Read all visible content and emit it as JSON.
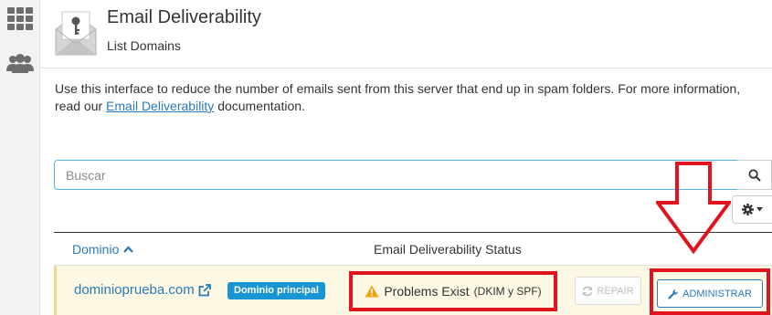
{
  "sidebar": {
    "items": [
      {
        "icon": "apps-grid-icon"
      },
      {
        "icon": "users-icon"
      }
    ]
  },
  "header": {
    "icon": "email-key-icon",
    "title": "Email Deliverability",
    "subtitle": "List Domains"
  },
  "description": {
    "before_link": "Use this interface to reduce the number of emails sent from this server that end up in spam folders. For more information, read our ",
    "link_text": "Email Deliverability",
    "after_link": " documentation."
  },
  "search": {
    "placeholder": "Buscar",
    "value": ""
  },
  "table": {
    "columns": {
      "domain": "Dominio",
      "status": "Email Deliverability Status"
    },
    "rows": [
      {
        "domain": "dominioprueba.com",
        "badge": "Dominio principal",
        "status": "Problems Exist",
        "status_detail": "(DKIM y SPF)",
        "repair_label": "REPAIR",
        "manage_label": "ADMINISTRAR"
      }
    ]
  },
  "colors": {
    "accent": "#2a7ab8",
    "badge": "#1895d2",
    "highlight": "#e0141e",
    "warning": "#f0a30a",
    "row_background": "#fcf8e3"
  }
}
